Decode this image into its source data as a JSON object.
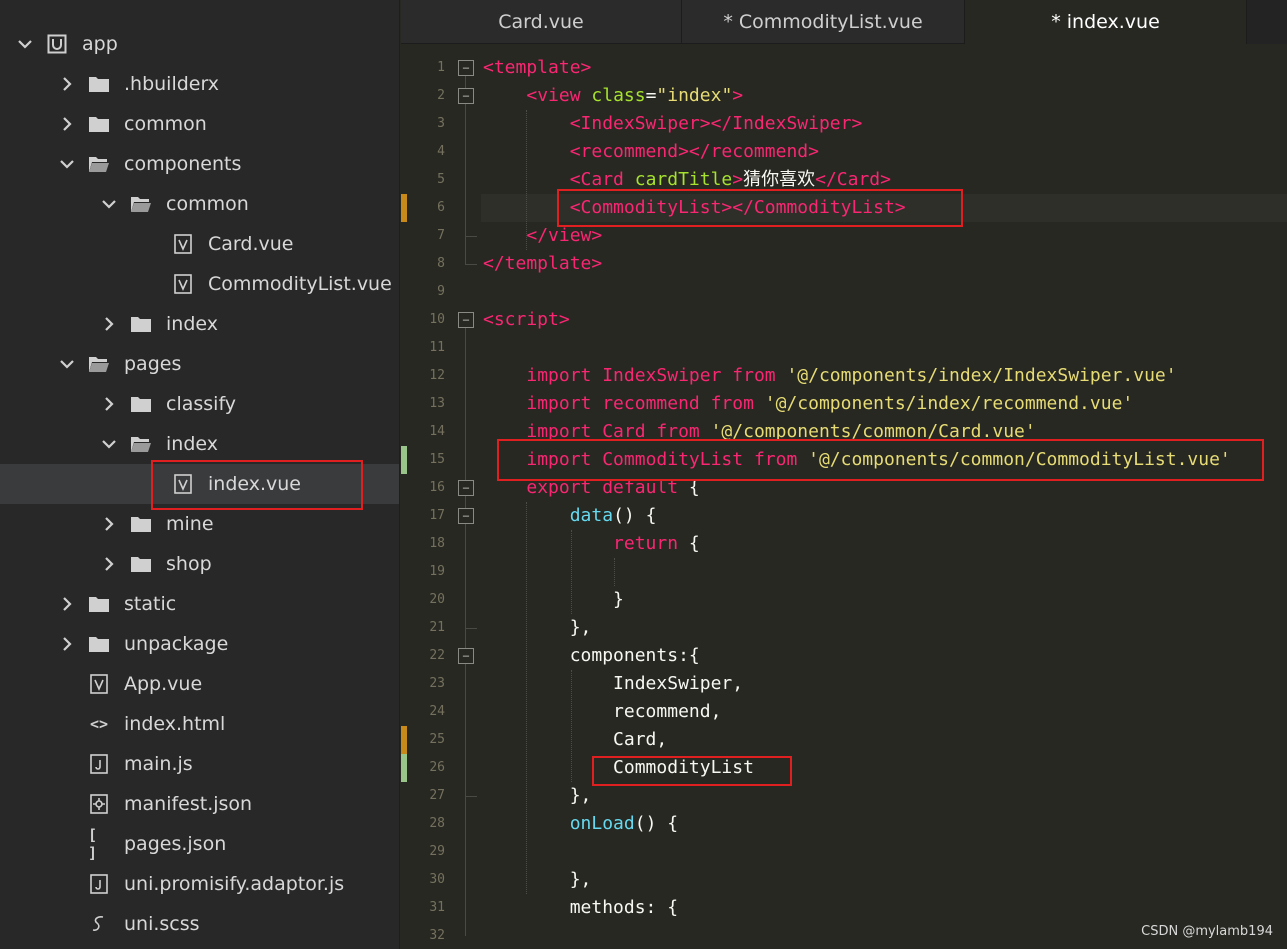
{
  "sidebar": {
    "items": [
      {
        "label": "app",
        "icon": "project-icon",
        "expanded": true
      },
      {
        "label": ".hbuilderx",
        "icon": "folder-icon",
        "expanded": false
      },
      {
        "label": "common",
        "icon": "folder-icon",
        "expanded": false
      },
      {
        "label": "components",
        "icon": "folder-open-icon",
        "expanded": true
      },
      {
        "label": "common",
        "icon": "folder-open-icon",
        "expanded": true
      },
      {
        "label": "Card.vue",
        "icon": "vue-file-icon"
      },
      {
        "label": "CommodityList.vue",
        "icon": "vue-file-icon"
      },
      {
        "label": "index",
        "icon": "folder-icon",
        "expanded": false
      },
      {
        "label": "pages",
        "icon": "folder-open-icon",
        "expanded": true
      },
      {
        "label": "classify",
        "icon": "folder-icon",
        "expanded": false
      },
      {
        "label": "index",
        "icon": "folder-open-icon",
        "expanded": true
      },
      {
        "label": "index.vue",
        "icon": "vue-file-icon",
        "selected": true
      },
      {
        "label": "mine",
        "icon": "folder-icon",
        "expanded": false
      },
      {
        "label": "shop",
        "icon": "folder-icon",
        "expanded": false
      },
      {
        "label": "static",
        "icon": "folder-icon",
        "expanded": false
      },
      {
        "label": "unpackage",
        "icon": "folder-icon",
        "expanded": false
      },
      {
        "label": "App.vue",
        "icon": "vue-file-icon"
      },
      {
        "label": "index.html",
        "icon": "html-file-icon"
      },
      {
        "label": "main.js",
        "icon": "js-file-icon"
      },
      {
        "label": "manifest.json",
        "icon": "manifest-file-icon"
      },
      {
        "label": "pages.json",
        "icon": "json-file-icon"
      },
      {
        "label": "uni.promisify.adaptor.js",
        "icon": "js-file-icon"
      },
      {
        "label": "uni.scss",
        "icon": "scss-file-icon"
      }
    ]
  },
  "tabs": [
    {
      "label": "Card.vue",
      "active": false
    },
    {
      "label": "* CommodityList.vue",
      "active": false
    },
    {
      "label": "* index.vue",
      "active": true
    }
  ],
  "editor": {
    "line_numbers": [
      "1",
      "2",
      "3",
      "4",
      "5",
      "6",
      "7",
      "8",
      "9",
      "10",
      "11",
      "12",
      "13",
      "14",
      "15",
      "16",
      "17",
      "18",
      "19",
      "20",
      "21",
      "22",
      "23",
      "24",
      "25",
      "26",
      "27",
      "28",
      "29",
      "30",
      "31",
      "32"
    ],
    "lines": [
      [
        [
          "tg",
          "<template>"
        ]
      ],
      [
        [
          "pl",
          "    "
        ],
        [
          "tg",
          "<view "
        ],
        [
          "at",
          "class"
        ],
        [
          "pl",
          "="
        ],
        [
          "st",
          "\"index\""
        ],
        [
          "tg",
          ">"
        ]
      ],
      [
        [
          "pl",
          "        "
        ],
        [
          "tg",
          "<IndexSwiper></IndexSwiper>"
        ]
      ],
      [
        [
          "pl",
          "        "
        ],
        [
          "tg",
          "<recommend></recommend>"
        ]
      ],
      [
        [
          "pl",
          "        "
        ],
        [
          "tg",
          "<Card "
        ],
        [
          "at",
          "cardTitle"
        ],
        [
          "tg",
          ">"
        ],
        [
          "pl",
          "猜你喜欢"
        ],
        [
          "tg",
          "</Card>"
        ]
      ],
      [
        [
          "pl",
          "        "
        ],
        [
          "tg",
          "<CommodityList></CommodityList>"
        ]
      ],
      [
        [
          "pl",
          "    "
        ],
        [
          "tg",
          "</view>"
        ]
      ],
      [
        [
          "tg",
          "</template>"
        ]
      ],
      [],
      [
        [
          "tg",
          "<script>"
        ]
      ],
      [],
      [
        [
          "pl",
          "    "
        ],
        [
          "kw",
          "import "
        ],
        [
          "tg",
          "IndexSwiper "
        ],
        [
          "kw",
          "from "
        ],
        [
          "st",
          "'@/components/index/IndexSwiper.vue'"
        ]
      ],
      [
        [
          "pl",
          "    "
        ],
        [
          "kw",
          "import "
        ],
        [
          "tg",
          "recommend "
        ],
        [
          "kw",
          "from "
        ],
        [
          "st",
          "'@/components/index/recommend.vue'"
        ]
      ],
      [
        [
          "pl",
          "    "
        ],
        [
          "kw",
          "import "
        ],
        [
          "tg",
          "Card "
        ],
        [
          "kw",
          "from "
        ],
        [
          "st",
          "'@/components/common/Card.vue'"
        ]
      ],
      [
        [
          "pl",
          "    "
        ],
        [
          "kw",
          "import "
        ],
        [
          "tg",
          "CommodityList "
        ],
        [
          "kw",
          "from "
        ],
        [
          "st",
          "'@/components/common/CommodityList.vue'"
        ]
      ],
      [
        [
          "pl",
          "    "
        ],
        [
          "kw",
          "export default "
        ],
        [
          "pl",
          "{"
        ]
      ],
      [
        [
          "pl",
          "        "
        ],
        [
          "fn",
          "data"
        ],
        [
          "pl",
          "() {"
        ]
      ],
      [
        [
          "pl",
          "            "
        ],
        [
          "kw",
          "return "
        ],
        [
          "pl",
          "{"
        ]
      ],
      [],
      [
        [
          "pl",
          "            }"
        ]
      ],
      [
        [
          "pl",
          "        },"
        ]
      ],
      [
        [
          "pl",
          "        components:{"
        ]
      ],
      [
        [
          "pl",
          "            IndexSwiper,"
        ]
      ],
      [
        [
          "pl",
          "            recommend,"
        ]
      ],
      [
        [
          "pl",
          "            Card,"
        ]
      ],
      [
        [
          "pl",
          "            CommodityList"
        ]
      ],
      [
        [
          "pl",
          "        },"
        ]
      ],
      [
        [
          "pl",
          "        "
        ],
        [
          "fn",
          "onLoad"
        ],
        [
          "pl",
          "() {"
        ]
      ],
      [],
      [
        [
          "pl",
          "        },"
        ]
      ],
      [
        [
          "pl",
          "        methods: {"
        ]
      ],
      []
    ],
    "current_line": "6",
    "fold_markers": [
      "1",
      "2",
      "10",
      "16",
      "17",
      "22"
    ],
    "change_markers": [
      {
        "line": "6",
        "color": "#c88a1a"
      },
      {
        "line": "15",
        "color": "#9ac58a"
      },
      {
        "line": "25",
        "color": "#c88a1a"
      },
      {
        "line": "26",
        "color": "#9ac58a"
      }
    ]
  },
  "watermark": "CSDN @mylamb194",
  "colors": {
    "annotation_box": "#e02020",
    "tag": "#f92672",
    "attribute": "#a6e22e",
    "string": "#e6db74",
    "function": "#66d9ef"
  }
}
